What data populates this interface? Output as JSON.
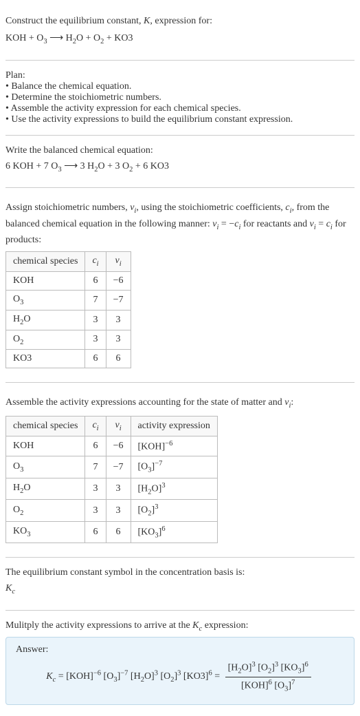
{
  "header": {
    "line1": "Construct the equilibrium constant, <i>K</i>, expression for:",
    "line2": "KOH + O<sub>3</sub> ⟶ H<sub>2</sub>O + O<sub>2</sub> + KO3"
  },
  "plan": {
    "title": "Plan:",
    "items": [
      "• Balance the chemical equation.",
      "• Determine the stoichiometric numbers.",
      "• Assemble the activity expression for each chemical species.",
      "• Use the activity expressions to build the equilibrium constant expression."
    ]
  },
  "balanced": {
    "title": "Write the balanced chemical equation:",
    "eq": "6 KOH + 7 O<sub>3</sub> ⟶ 3 H<sub>2</sub>O + 3 O<sub>2</sub> + 6 KO3"
  },
  "stoich": {
    "intro": "Assign stoichiometric numbers, <i>ν<sub>i</sub></i>, using the stoichiometric coefficients, <i>c<sub>i</sub></i>, from the balanced chemical equation in the following manner: <i>ν<sub>i</sub></i> = −<i>c<sub>i</sub></i> for reactants and <i>ν<sub>i</sub></i> = <i>c<sub>i</sub></i> for products:",
    "headers": [
      "chemical species",
      "<i>c<sub>i</sub></i>",
      "<i>ν<sub>i</sub></i>"
    ],
    "rows": [
      [
        "KOH",
        "6",
        "−6"
      ],
      [
        "O<sub>3</sub>",
        "7",
        "−7"
      ],
      [
        "H<sub>2</sub>O",
        "3",
        "3"
      ],
      [
        "O<sub>2</sub>",
        "3",
        "3"
      ],
      [
        "KO3",
        "6",
        "6"
      ]
    ]
  },
  "activity": {
    "intro": "Assemble the activity expressions accounting for the state of matter and <i>ν<sub>i</sub></i>:",
    "headers": [
      "chemical species",
      "<i>c<sub>i</sub></i>",
      "<i>ν<sub>i</sub></i>",
      "activity expression"
    ],
    "rows": [
      [
        "KOH",
        "6",
        "−6",
        "[KOH]<sup>−6</sup>"
      ],
      [
        "O<sub>3</sub>",
        "7",
        "−7",
        "[O<sub>3</sub>]<sup>−7</sup>"
      ],
      [
        "H<sub>2</sub>O",
        "3",
        "3",
        "[H<sub>2</sub>O]<sup>3</sup>"
      ],
      [
        "O<sub>2</sub>",
        "3",
        "3",
        "[O<sub>2</sub>]<sup>3</sup>"
      ],
      [
        "KO<sub>3</sub>",
        "6",
        "6",
        "[KO<sub>3</sub>]<sup>6</sup>"
      ]
    ]
  },
  "symbol": {
    "line1": "The equilibrium constant symbol in the concentration basis is:",
    "line2": "<i>K<sub>c</sub></i>"
  },
  "multiply": {
    "line": "Mulitply the activity expressions to arrive at the <i>K<sub>c</sub></i> expression:"
  },
  "answer": {
    "label": "Answer:",
    "lhs": "<i>K<sub>c</sub></i> = [KOH]<sup>−6</sup> [O<sub>3</sub>]<sup>−7</sup> [H<sub>2</sub>O]<sup>3</sup> [O<sub>2</sub>]<sup>3</sup> [KO3]<sup>6</sup> = ",
    "frac_num": "[H<sub>2</sub>O]<sup>3</sup> [O<sub>2</sub>]<sup>3</sup> [KO<sub>3</sub>]<sup>6</sup>",
    "frac_den": "[KOH]<sup>6</sup> [O<sub>3</sub>]<sup>7</sup>"
  }
}
